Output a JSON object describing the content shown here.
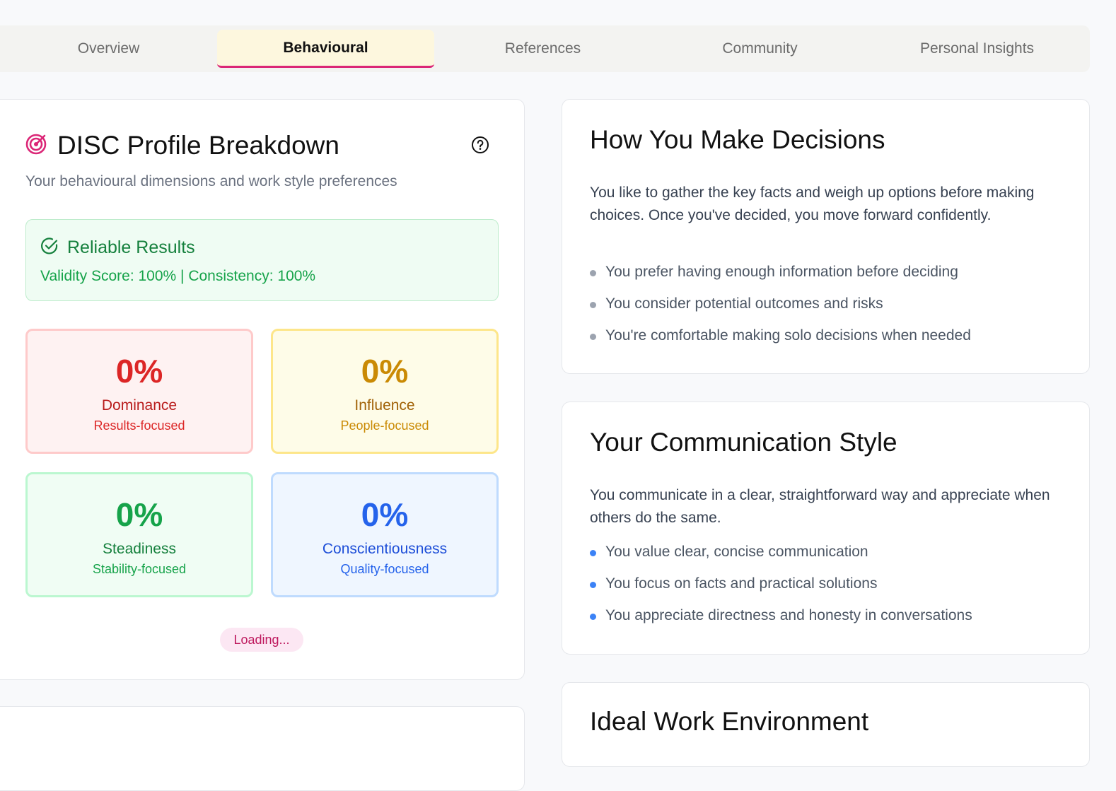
{
  "tabs": [
    {
      "label": "Overview",
      "active": false
    },
    {
      "label": "Behavioural",
      "active": true
    },
    {
      "label": "References",
      "active": false
    },
    {
      "label": "Community",
      "active": false
    },
    {
      "label": "Personal Insights",
      "active": false
    }
  ],
  "disc": {
    "title": "DISC Profile Breakdown",
    "subtitle": "Your behavioural dimensions and work style preferences",
    "icon": "target-icon",
    "help_icon": "help-circle-icon",
    "reliability": {
      "title": "Reliable Results",
      "detail": "Validity Score: 100% | Consistency: 100%",
      "icon": "check-circle-icon"
    },
    "dimensions": [
      {
        "percent": "0%",
        "name": "Dominance",
        "desc": "Results-focused",
        "color": "#dc2626"
      },
      {
        "percent": "0%",
        "name": "Influence",
        "desc": "People-focused",
        "color": "#ca8a04"
      },
      {
        "percent": "0%",
        "name": "Steadiness",
        "desc": "Stability-focused",
        "color": "#16a34a"
      },
      {
        "percent": "0%",
        "name": "Conscientiousness",
        "desc": "Quality-focused",
        "color": "#2563eb"
      }
    ],
    "loading_label": "Loading..."
  },
  "decisions": {
    "title": "How You Make Decisions",
    "paragraph": "You like to gather the key facts and weigh up options before making choices. Once you've decided, you move forward confidently.",
    "bullets": [
      "You prefer having enough information before deciding",
      "You consider potential outcomes and risks",
      "You're comfortable making solo decisions when needed"
    ]
  },
  "communication": {
    "title": "Your Communication Style",
    "paragraph": "You communicate in a clear, straightforward way and appreciate when others do the same.",
    "bullets": [
      "You value clear, concise communication",
      "You focus on facts and practical solutions",
      "You appreciate directness and honesty in conversations"
    ]
  },
  "environment": {
    "title": "Ideal Work Environment"
  },
  "colors": {
    "accent": "#db2777",
    "active_tab_bg": "#fdf7de"
  }
}
